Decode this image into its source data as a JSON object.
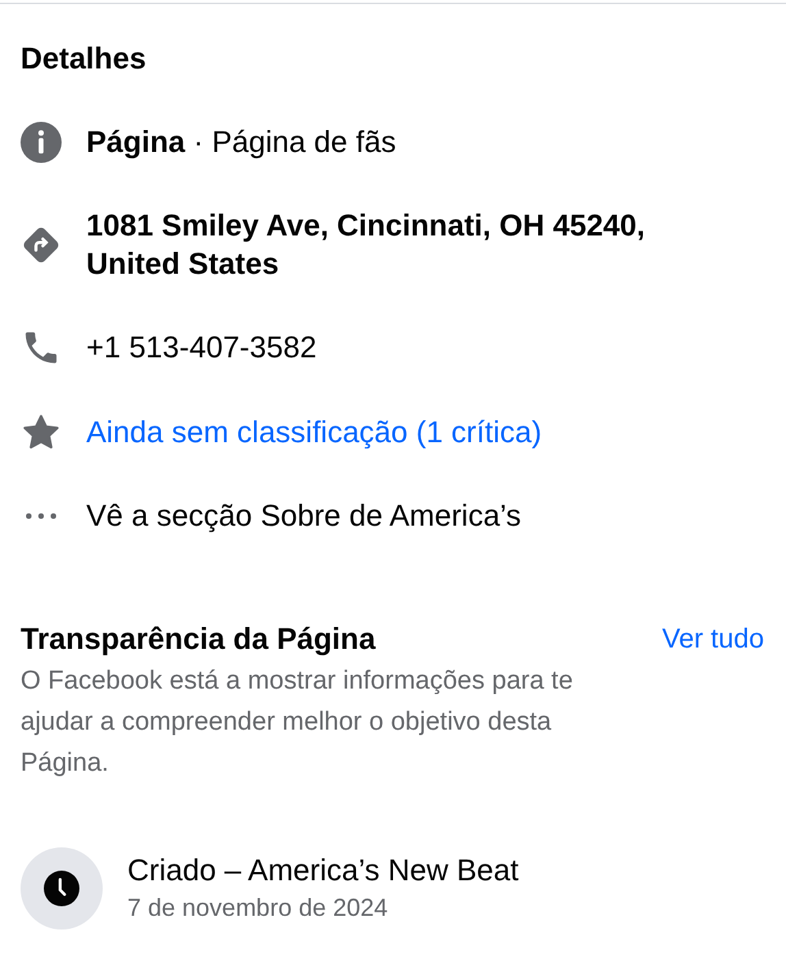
{
  "details": {
    "title": "Detalhes",
    "items": [
      {
        "kind": "info",
        "text": "**Página** · Página de fãs"
      },
      {
        "kind": "address",
        "text": "**1081 Smiley Ave, Cincinnati, OH 45240, United States**"
      },
      {
        "kind": "phone",
        "text": "+1 513-407-3582"
      },
      {
        "kind": "rating",
        "text": "Ainda sem classificação (1 crítica)"
      },
      {
        "kind": "more",
        "text": "Vê a secção Sobre de America’s"
      }
    ]
  },
  "transparency": {
    "title": "Transparência da Página",
    "link": "Ver tudo",
    "description": "O Facebook está a mostrar informações para te ajudar a compreender melhor o objetivo desta Página.",
    "created": {
      "title": "Criado – America’s New Beat",
      "date": "7 de novembro de 2024"
    }
  }
}
